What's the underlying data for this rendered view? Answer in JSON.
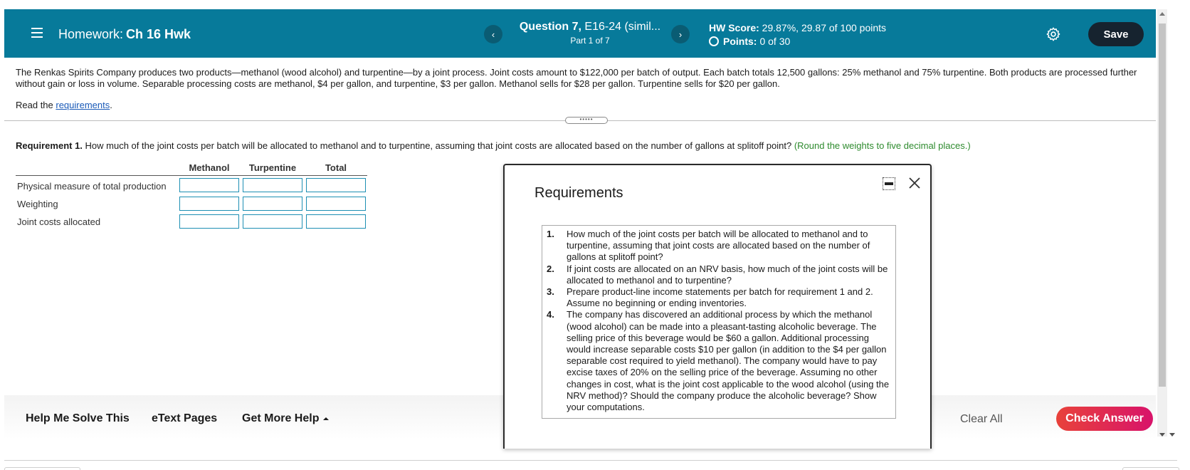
{
  "header": {
    "hw_label": "Homework:",
    "hw_name": "Ch 16 Hwk",
    "question_bold": "Question 7,",
    "question_rest": " E16-24 (simil...",
    "part": "Part 1 of 7",
    "score_label": "HW Score:",
    "score_value": " 29.87%, 29.87 of 100 points",
    "points_label": "Points:",
    "points_value": "0 of 30",
    "prev_icon": "‹",
    "next_icon": "›",
    "save_label": "Save"
  },
  "problem": {
    "text": "The Renkas Spirits Company produces two products—methanol (wood alcohol) and turpentine—by a joint process. Joint costs amount to $122,000 per batch of output. Each batch totals 12,500 gallons: 25% methanol and 75% turpentine. Both products are processed further without gain or loss in volume. Separable processing costs are methanol, $4 per gallon, and turpentine, $3 per gallon. Methanol sells for $28 per gallon. Turpentine sells for $20 per gallon.",
    "read_prefix": "Read the ",
    "read_link": "requirements",
    "read_suffix": "."
  },
  "requirement1": {
    "label": "Requirement 1.",
    "text": " How much of the joint costs per batch will be allocated to methanol and to turpentine, assuming that joint costs are allocated based on the number of gallons at splitoff point? ",
    "hint": "(Round the weights to five decimal places.)"
  },
  "table": {
    "columns": [
      "Methanol",
      "Turpentine",
      "Total"
    ],
    "rows": [
      "Physical measure of total production",
      "Weighting",
      "Joint costs allocated"
    ]
  },
  "toolbar": {
    "help_me_solve": "Help Me Solve This",
    "etext": "eText Pages",
    "get_more_help": "Get More Help",
    "clear_all": "Clear All",
    "check_answer": "Check Answer"
  },
  "dialog": {
    "title": "Requirements",
    "items": [
      {
        "num": "1.",
        "text": "How much of the joint costs per batch will be allocated to methanol and to turpentine, assuming that joint costs are allocated based on the number of gallons at splitoff point?"
      },
      {
        "num": "2.",
        "text": "If joint costs are allocated on an NRV basis, how much of the joint costs will be allocated to methanol and to turpentine?"
      },
      {
        "num": "3.",
        "text": "Prepare product-line income statements per batch for requirement 1 and 2. Assume no beginning or ending inventories."
      },
      {
        "num": "4.",
        "text": "The company has discovered an additional process by which the methanol (wood alcohol) can be made into a pleasant-tasting alcoholic beverage. The selling price of this beverage would be $60 a gallon. Additional processing would increase separable costs $10 per gallon (in addition to the $4 per gallon separable cost required to yield methanol). The company would have to pay excise taxes of 20% on the selling price of the beverage. Assuming no other changes in cost, what is the joint cost applicable to the wood alcohol (using the NRV method)? Should the company produce the alcoholic beverage? Show your computations."
      }
    ]
  },
  "colors": {
    "header_bg": "#077a9a",
    "save_bg": "#16232f",
    "check_answer_start": "#e8423a",
    "check_answer_end": "#d8136a",
    "hint": "#2e8b2e",
    "link": "#1a5ab8",
    "input_border": "#1d8fb3"
  }
}
